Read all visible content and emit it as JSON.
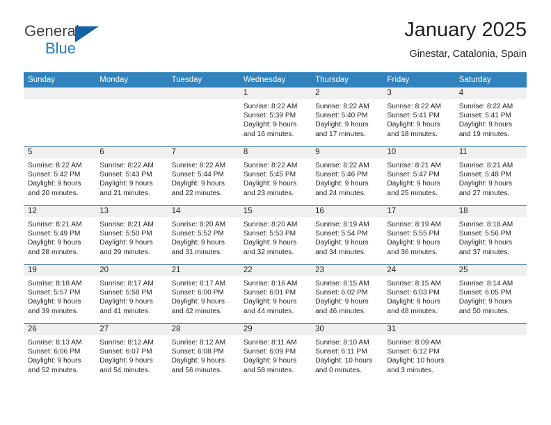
{
  "brand": {
    "name_part1": "General",
    "name_part2": "Blue",
    "accent_color": "#1d7fc4"
  },
  "header": {
    "title": "January 2025",
    "subtitle": "Ginestar, Catalonia, Spain"
  },
  "theme": {
    "header_blue": "#3182bd",
    "rule_blue": "#2b6ca3",
    "daynum_band": "#f0f0f0"
  },
  "weekday_headers": [
    "Sunday",
    "Monday",
    "Tuesday",
    "Wednesday",
    "Thursday",
    "Friday",
    "Saturday"
  ],
  "weeks": [
    [
      {
        "day": "",
        "sunrise": "",
        "sunset": "",
        "daylight_line1": "",
        "daylight_line2": ""
      },
      {
        "day": "",
        "sunrise": "",
        "sunset": "",
        "daylight_line1": "",
        "daylight_line2": ""
      },
      {
        "day": "",
        "sunrise": "",
        "sunset": "",
        "daylight_line1": "",
        "daylight_line2": ""
      },
      {
        "day": "1",
        "sunrise": "Sunrise: 8:22 AM",
        "sunset": "Sunset: 5:39 PM",
        "daylight_line1": "Daylight: 9 hours",
        "daylight_line2": "and 16 minutes."
      },
      {
        "day": "2",
        "sunrise": "Sunrise: 8:22 AM",
        "sunset": "Sunset: 5:40 PM",
        "daylight_line1": "Daylight: 9 hours",
        "daylight_line2": "and 17 minutes."
      },
      {
        "day": "3",
        "sunrise": "Sunrise: 8:22 AM",
        "sunset": "Sunset: 5:41 PM",
        "daylight_line1": "Daylight: 9 hours",
        "daylight_line2": "and 18 minutes."
      },
      {
        "day": "4",
        "sunrise": "Sunrise: 8:22 AM",
        "sunset": "Sunset: 5:41 PM",
        "daylight_line1": "Daylight: 9 hours",
        "daylight_line2": "and 19 minutes."
      }
    ],
    [
      {
        "day": "5",
        "sunrise": "Sunrise: 8:22 AM",
        "sunset": "Sunset: 5:42 PM",
        "daylight_line1": "Daylight: 9 hours",
        "daylight_line2": "and 20 minutes."
      },
      {
        "day": "6",
        "sunrise": "Sunrise: 8:22 AM",
        "sunset": "Sunset: 5:43 PM",
        "daylight_line1": "Daylight: 9 hours",
        "daylight_line2": "and 21 minutes."
      },
      {
        "day": "7",
        "sunrise": "Sunrise: 8:22 AM",
        "sunset": "Sunset: 5:44 PM",
        "daylight_line1": "Daylight: 9 hours",
        "daylight_line2": "and 22 minutes."
      },
      {
        "day": "8",
        "sunrise": "Sunrise: 8:22 AM",
        "sunset": "Sunset: 5:45 PM",
        "daylight_line1": "Daylight: 9 hours",
        "daylight_line2": "and 23 minutes."
      },
      {
        "day": "9",
        "sunrise": "Sunrise: 8:22 AM",
        "sunset": "Sunset: 5:46 PM",
        "daylight_line1": "Daylight: 9 hours",
        "daylight_line2": "and 24 minutes."
      },
      {
        "day": "10",
        "sunrise": "Sunrise: 8:21 AM",
        "sunset": "Sunset: 5:47 PM",
        "daylight_line1": "Daylight: 9 hours",
        "daylight_line2": "and 25 minutes."
      },
      {
        "day": "11",
        "sunrise": "Sunrise: 8:21 AM",
        "sunset": "Sunset: 5:48 PM",
        "daylight_line1": "Daylight: 9 hours",
        "daylight_line2": "and 27 minutes."
      }
    ],
    [
      {
        "day": "12",
        "sunrise": "Sunrise: 8:21 AM",
        "sunset": "Sunset: 5:49 PM",
        "daylight_line1": "Daylight: 9 hours",
        "daylight_line2": "and 28 minutes."
      },
      {
        "day": "13",
        "sunrise": "Sunrise: 8:21 AM",
        "sunset": "Sunset: 5:50 PM",
        "daylight_line1": "Daylight: 9 hours",
        "daylight_line2": "and 29 minutes."
      },
      {
        "day": "14",
        "sunrise": "Sunrise: 8:20 AM",
        "sunset": "Sunset: 5:52 PM",
        "daylight_line1": "Daylight: 9 hours",
        "daylight_line2": "and 31 minutes."
      },
      {
        "day": "15",
        "sunrise": "Sunrise: 8:20 AM",
        "sunset": "Sunset: 5:53 PM",
        "daylight_line1": "Daylight: 9 hours",
        "daylight_line2": "and 32 minutes."
      },
      {
        "day": "16",
        "sunrise": "Sunrise: 8:19 AM",
        "sunset": "Sunset: 5:54 PM",
        "daylight_line1": "Daylight: 9 hours",
        "daylight_line2": "and 34 minutes."
      },
      {
        "day": "17",
        "sunrise": "Sunrise: 8:19 AM",
        "sunset": "Sunset: 5:55 PM",
        "daylight_line1": "Daylight: 9 hours",
        "daylight_line2": "and 36 minutes."
      },
      {
        "day": "18",
        "sunrise": "Sunrise: 8:18 AM",
        "sunset": "Sunset: 5:56 PM",
        "daylight_line1": "Daylight: 9 hours",
        "daylight_line2": "and 37 minutes."
      }
    ],
    [
      {
        "day": "19",
        "sunrise": "Sunrise: 8:18 AM",
        "sunset": "Sunset: 5:57 PM",
        "daylight_line1": "Daylight: 9 hours",
        "daylight_line2": "and 39 minutes."
      },
      {
        "day": "20",
        "sunrise": "Sunrise: 8:17 AM",
        "sunset": "Sunset: 5:58 PM",
        "daylight_line1": "Daylight: 9 hours",
        "daylight_line2": "and 41 minutes."
      },
      {
        "day": "21",
        "sunrise": "Sunrise: 8:17 AM",
        "sunset": "Sunset: 6:00 PM",
        "daylight_line1": "Daylight: 9 hours",
        "daylight_line2": "and 42 minutes."
      },
      {
        "day": "22",
        "sunrise": "Sunrise: 8:16 AM",
        "sunset": "Sunset: 6:01 PM",
        "daylight_line1": "Daylight: 9 hours",
        "daylight_line2": "and 44 minutes."
      },
      {
        "day": "23",
        "sunrise": "Sunrise: 8:15 AM",
        "sunset": "Sunset: 6:02 PM",
        "daylight_line1": "Daylight: 9 hours",
        "daylight_line2": "and 46 minutes."
      },
      {
        "day": "24",
        "sunrise": "Sunrise: 8:15 AM",
        "sunset": "Sunset: 6:03 PM",
        "daylight_line1": "Daylight: 9 hours",
        "daylight_line2": "and 48 minutes."
      },
      {
        "day": "25",
        "sunrise": "Sunrise: 8:14 AM",
        "sunset": "Sunset: 6:05 PM",
        "daylight_line1": "Daylight: 9 hours",
        "daylight_line2": "and 50 minutes."
      }
    ],
    [
      {
        "day": "26",
        "sunrise": "Sunrise: 8:13 AM",
        "sunset": "Sunset: 6:06 PM",
        "daylight_line1": "Daylight: 9 hours",
        "daylight_line2": "and 52 minutes."
      },
      {
        "day": "27",
        "sunrise": "Sunrise: 8:12 AM",
        "sunset": "Sunset: 6:07 PM",
        "daylight_line1": "Daylight: 9 hours",
        "daylight_line2": "and 54 minutes."
      },
      {
        "day": "28",
        "sunrise": "Sunrise: 8:12 AM",
        "sunset": "Sunset: 6:08 PM",
        "daylight_line1": "Daylight: 9 hours",
        "daylight_line2": "and 56 minutes."
      },
      {
        "day": "29",
        "sunrise": "Sunrise: 8:11 AM",
        "sunset": "Sunset: 6:09 PM",
        "daylight_line1": "Daylight: 9 hours",
        "daylight_line2": "and 58 minutes."
      },
      {
        "day": "30",
        "sunrise": "Sunrise: 8:10 AM",
        "sunset": "Sunset: 6:11 PM",
        "daylight_line1": "Daylight: 10 hours",
        "daylight_line2": "and 0 minutes."
      },
      {
        "day": "31",
        "sunrise": "Sunrise: 8:09 AM",
        "sunset": "Sunset: 6:12 PM",
        "daylight_line1": "Daylight: 10 hours",
        "daylight_line2": "and 3 minutes."
      },
      {
        "day": "",
        "sunrise": "",
        "sunset": "",
        "daylight_line1": "",
        "daylight_line2": ""
      }
    ]
  ]
}
